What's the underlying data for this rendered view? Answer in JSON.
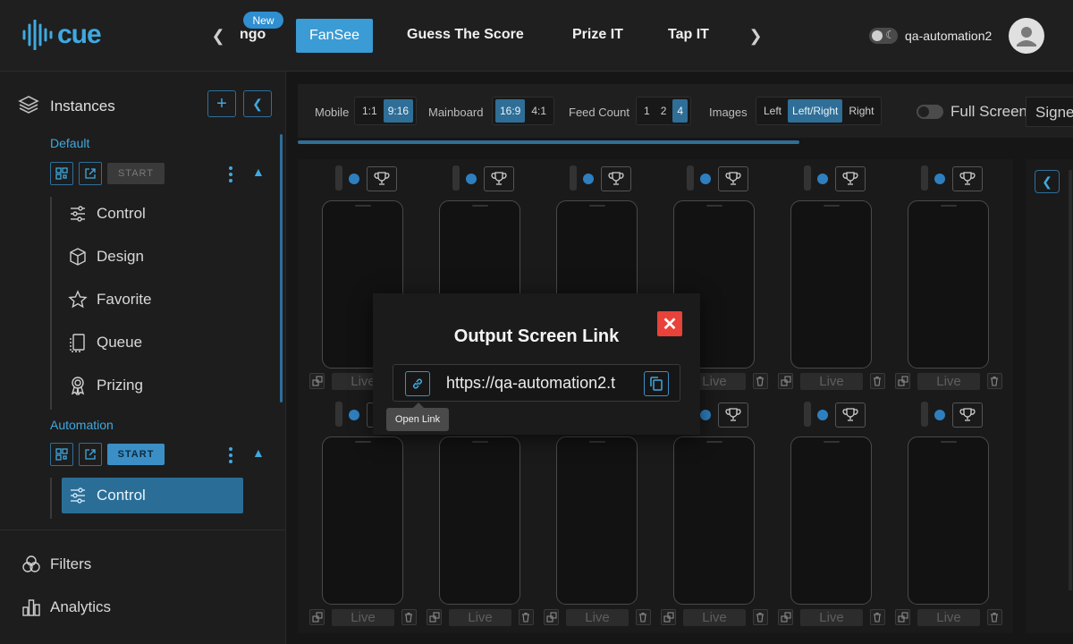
{
  "header": {
    "logo_text": "cue",
    "new_badge": "New",
    "nav": [
      {
        "label": "ngo"
      },
      {
        "label": "FanSee"
      },
      {
        "label": "Guess The Score"
      },
      {
        "label": "Prize IT"
      },
      {
        "label": "Tap IT"
      }
    ],
    "user": "qa-automation2"
  },
  "sidebar": {
    "title": "Instances",
    "groups": [
      {
        "label": "Default",
        "start_label": "START",
        "items": [
          {
            "label": "Control",
            "icon": "sliders-icon"
          },
          {
            "label": "Design",
            "icon": "cube-icon"
          },
          {
            "label": "Favorite",
            "icon": "star-icon"
          },
          {
            "label": "Queue",
            "icon": "queue-icon"
          },
          {
            "label": "Prizing",
            "icon": "award-icon"
          }
        ]
      },
      {
        "label": "Automation",
        "start_label": "START",
        "items": [
          {
            "label": "Control",
            "icon": "sliders-icon"
          }
        ]
      }
    ],
    "footer": [
      {
        "label": "Filters",
        "icon": "filters-icon"
      },
      {
        "label": "Analytics",
        "icon": "analytics-icon"
      }
    ]
  },
  "toolbar": {
    "mobile_label": "Mobile",
    "mobile_options": [
      "1:1",
      "9:16"
    ],
    "mobile_selected": "9:16",
    "mainboard_label": "Mainboard",
    "mainboard_options": [
      "16:9",
      "4:1"
    ],
    "mainboard_selected": "16:9",
    "feed_label": "Feed Count",
    "feed_options": [
      "1",
      "2",
      "4"
    ],
    "feed_selected": "4",
    "images_label": "Images",
    "images_options": [
      "Left",
      "Left/Right",
      "Right"
    ],
    "images_selected": "Left/Right",
    "fullscreen_label": "Full Screen",
    "sign_text": "Signe"
  },
  "grid": {
    "live_label": "Live"
  },
  "modal": {
    "title": "Output Screen Link",
    "url": "https://qa-automation2.t",
    "tooltip": "Open Link"
  },
  "colors": {
    "accent": "#3b9bd4",
    "close": "#e8423a",
    "background": "#161616"
  }
}
